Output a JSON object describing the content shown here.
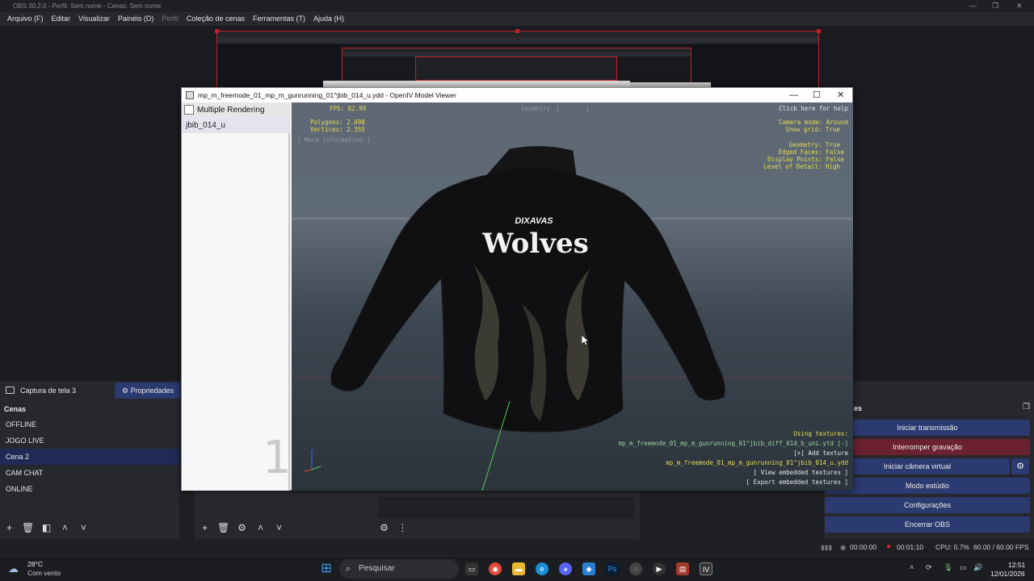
{
  "obs": {
    "title": "OBS 30.2.0 - Perfil: Sem nome - Cenas: Sem nome",
    "menu": [
      "Arquivo (F)",
      "Editar",
      "Visualizar",
      "Painéis (D)",
      "Perfil",
      "Coleção de cenas",
      "Ferramentas (T)",
      "Ajuda (H)"
    ],
    "source_name": "Captura de tela 3",
    "properties_label": "Propriedades",
    "scenes_header": "Cenas",
    "scenes": [
      "OFFLINE",
      "JOGO LIVE",
      "Cena 2",
      "CAM CHAT",
      "ONLINE"
    ],
    "selected_scene": "Cena 2",
    "controls_header": "es",
    "controls": {
      "stream": "Iniciar transmissão",
      "stop_record": "Interromper gravação",
      "virtual_cam": "Iniciar câmera virtual",
      "studio": "Modo estúdio",
      "settings": "Configurações",
      "exit": "Encerrar OBS"
    },
    "status": {
      "stream_time": "00:00:00",
      "record_time": "00:01:10",
      "cpu": "CPU: 0.7%",
      "fps": "60.00 / 60.00 FPS"
    }
  },
  "openiv": {
    "title": "mp_m_freemode_01_mp_m_gunrunning_01^jbib_014_u.ydd - OpenIV Model Viewer",
    "multiple_rendering": "Multiple Rendering",
    "model_item": "jbib_014_u",
    "lod_number": "1",
    "fps": "FPS: 62.99",
    "tabs": [
      "Geometry",
      "|",
      "|"
    ],
    "help": "Click here for help",
    "polygons": "Polygons: 2.898",
    "vertices": "Vertices: 2.355",
    "more_info": "[ More information ]",
    "camera_mode": "Camera mode: Around",
    "show_grid": "Show grid: True",
    "geometry": "Geometry: True",
    "edged_faces": "Edged Faces: False",
    "display_points": "Display Points: False",
    "lod": "Level of Detail: High",
    "using_textures": "Using textures:",
    "texture_1": "mp_m_freemode_01_mp_m_gunrunning_01^jbib_diff_014_b_uni.ytd [-]",
    "add_texture": "[+] Add texture",
    "texture_2": "mp_m_freemode_01_mp_m_gunrunning_01^jbib_014_u.ydd",
    "view_embedded": "[ View embedded textures ]",
    "export_embedded": "[ Export embedded textures ]",
    "jacket_text_top": "DIXAVAS",
    "jacket_text_main": "Wolves"
  },
  "taskbar": {
    "weather_temp": "28°C",
    "weather_desc": "Com vento",
    "search": "Pesquisar",
    "time": "12:51",
    "date": "12/01/2026"
  },
  "colors": {
    "accent_blue": "#2b3a70",
    "record_red": "#6b2130",
    "selection_red": "#c0202a",
    "hud_yellow": "#e7dc52",
    "hud_green": "#9fd49a"
  }
}
